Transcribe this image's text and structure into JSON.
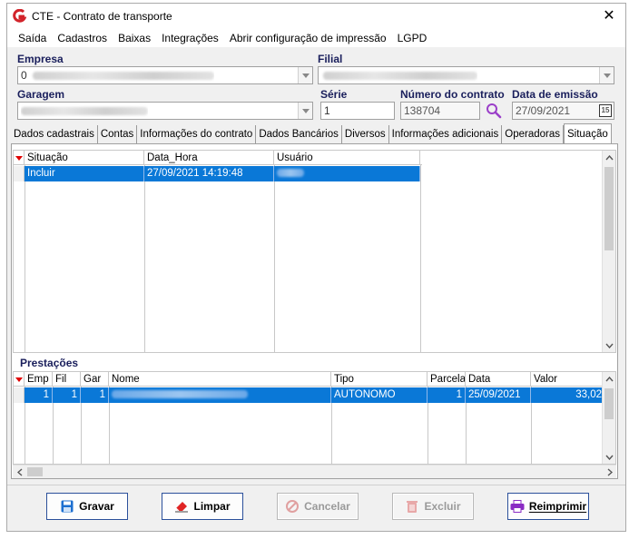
{
  "window": {
    "title": "CTE - Contrato de transporte",
    "close_glyph": "✕"
  },
  "menu": [
    "Saída",
    "Cadastros",
    "Baixas",
    "Integrações",
    "Abrir configuração de impressão",
    "LGPD"
  ],
  "form": {
    "empresa_label": "Empresa",
    "empresa_value_prefix": "0",
    "filial_label": "Filial",
    "garagem_label": "Garagem",
    "serie_label": "Série",
    "serie_value": "1",
    "numero_label": "Número do contrato",
    "numero_value": "138704",
    "data_label": "Data de emissão",
    "data_value": "27/09/2021",
    "calendar_glyph": "15"
  },
  "tabs": [
    {
      "label": "Dados cadastrais",
      "active": false
    },
    {
      "label": "Contas",
      "active": false
    },
    {
      "label": "Informações do contrato",
      "active": false
    },
    {
      "label": "Dados Bancários",
      "active": false
    },
    {
      "label": "Diversos",
      "active": false
    },
    {
      "label": "Informações adicionais",
      "active": false
    },
    {
      "label": "Operadoras",
      "active": false
    },
    {
      "label": "Situação",
      "active": true
    }
  ],
  "situacao_grid": {
    "columns": [
      "Situação",
      "Data_Hora",
      "Usuário"
    ],
    "rows": [
      {
        "situacao": "Incluir",
        "data_hora": "27/09/2021 14:19:48",
        "usuario": ""
      }
    ]
  },
  "prestacoes": {
    "title": "Prestações",
    "columns": [
      "Emp",
      "Fil",
      "Gar",
      "Nome",
      "Tipo",
      "Parcela",
      "Data",
      "Valor"
    ],
    "rows": [
      {
        "emp": "1",
        "fil": "1",
        "gar": "1",
        "nome": "",
        "tipo": "AUTONOMO",
        "parcela": "1",
        "data": "25/09/2021",
        "valor": "33,02"
      }
    ]
  },
  "buttons": {
    "gravar": "Gravar",
    "limpar": "Limpar",
    "cancelar": "Cancelar",
    "excluir": "Excluir",
    "reimprimir": "Reimprimir"
  },
  "colors": {
    "selection": "#0a78d7",
    "label": "#1a1f5c",
    "button_border": "#2a4f9a",
    "logo": "#d2232a"
  }
}
